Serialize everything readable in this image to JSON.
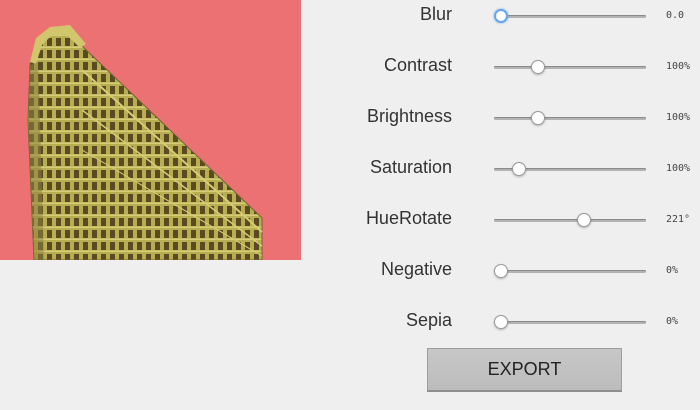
{
  "preview": {
    "background": "#ec7173",
    "building_color": "#b8ad50"
  },
  "controls": [
    {
      "label": "Blur",
      "value": "0.0",
      "fraction": 0.0,
      "focused": true
    },
    {
      "label": "Contrast",
      "value": "100%",
      "fraction": 0.27,
      "focused": false
    },
    {
      "label": "Brightness",
      "value": "100%",
      "fraction": 0.27,
      "focused": false
    },
    {
      "label": "Saturation",
      "value": "100%",
      "fraction": 0.13,
      "focused": false
    },
    {
      "label": "HueRotate",
      "value": "221°",
      "fraction": 0.6,
      "focused": false
    },
    {
      "label": "Negative",
      "value": "0%",
      "fraction": 0.0,
      "focused": false
    },
    {
      "label": "Sepia",
      "value": "0%",
      "fraction": 0.0,
      "focused": false
    }
  ],
  "export_label": "EXPORT"
}
